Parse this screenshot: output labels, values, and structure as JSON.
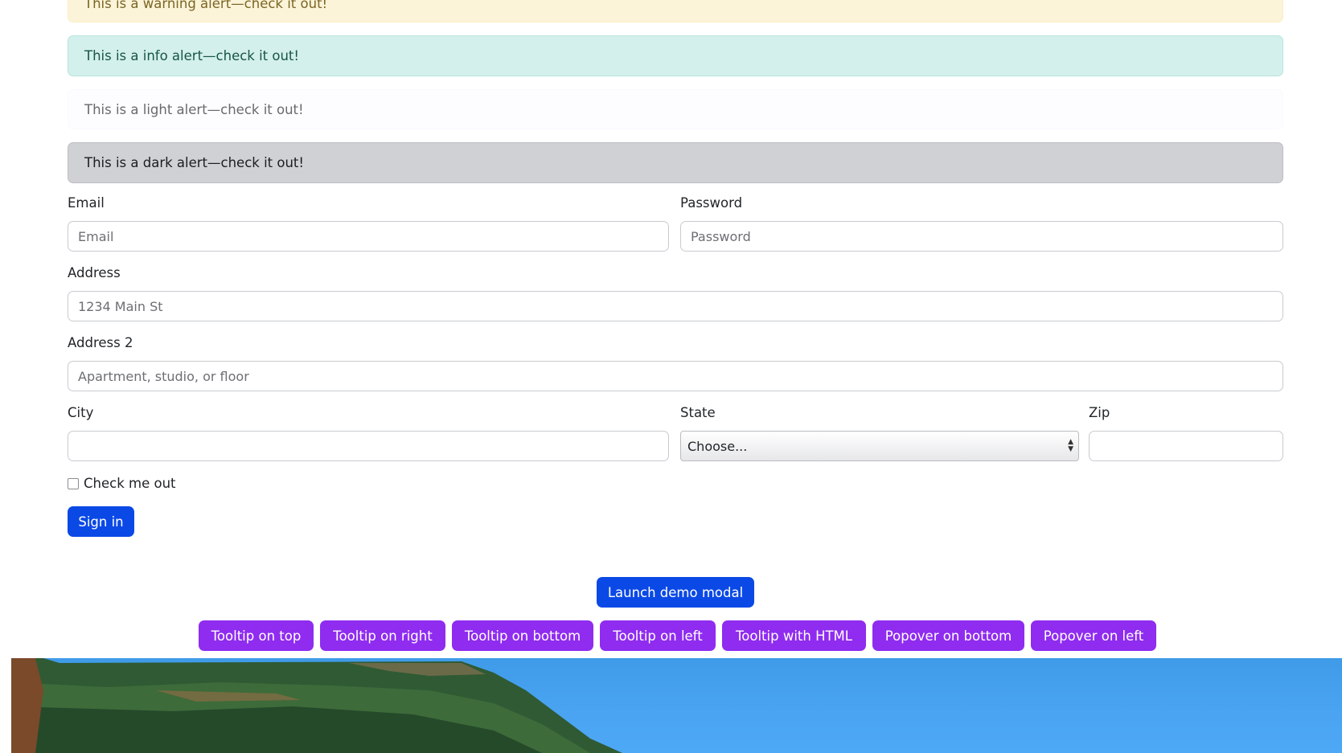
{
  "alerts": {
    "warning": "This is a warning alert—check it out!",
    "info": "This is a info alert—check it out!",
    "light": "This is a light alert—check it out!",
    "dark": "This is a dark alert—check it out!"
  },
  "form": {
    "email": {
      "label": "Email",
      "placeholder": "Email",
      "value": ""
    },
    "password": {
      "label": "Password",
      "placeholder": "Password",
      "value": ""
    },
    "address": {
      "label": "Address",
      "placeholder": "1234 Main St",
      "value": ""
    },
    "address2": {
      "label": "Address 2",
      "placeholder": "Apartment, studio, or floor",
      "value": ""
    },
    "city": {
      "label": "City",
      "value": ""
    },
    "state": {
      "label": "State",
      "selected": "Choose..."
    },
    "zip": {
      "label": "Zip",
      "value": ""
    },
    "checkbox": {
      "label": "Check me out",
      "checked": false
    },
    "submit": "Sign in"
  },
  "modal_button": "Launch demo modal",
  "tooltip_buttons": [
    "Tooltip on top",
    "Tooltip on right",
    "Tooltip on bottom",
    "Tooltip on left",
    "Tooltip with HTML",
    "Popover on bottom",
    "Popover on left"
  ],
  "colors": {
    "primary": "#0b49e6",
    "purple": "#8f2cf0",
    "sky": "#4aa4f2"
  }
}
